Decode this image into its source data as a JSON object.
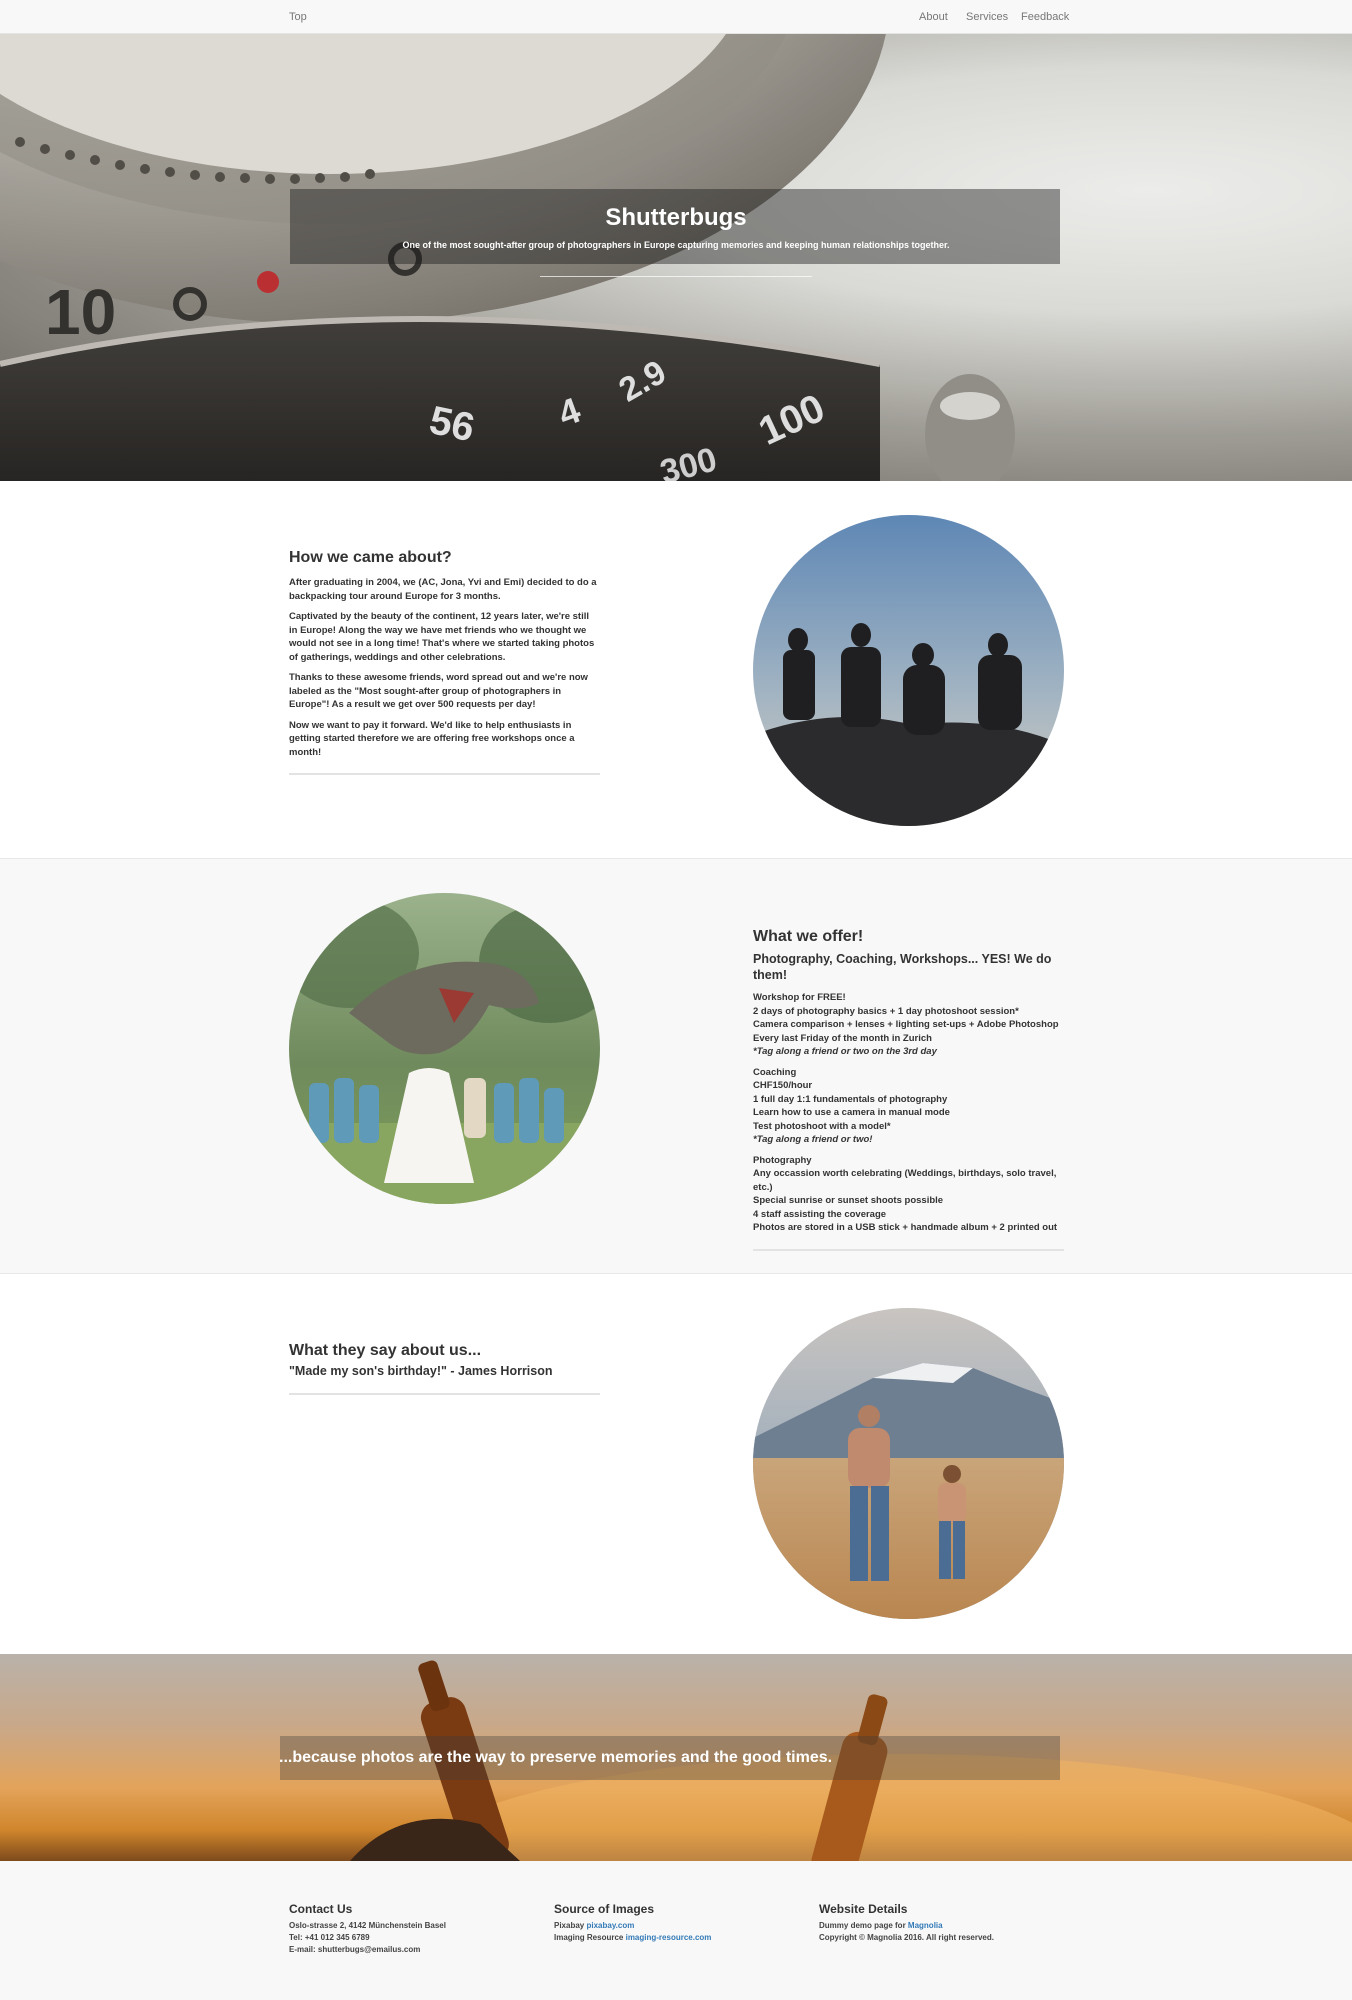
{
  "nav": {
    "top": "Top",
    "about": "About",
    "services": "Services",
    "feedback": "Feedback"
  },
  "hero": {
    "title": "Shutterbugs",
    "subtitle": "One of the most sought-after group of photographers in Europe capturing memories and keeping human relationships together."
  },
  "about": {
    "heading": "How we came about?",
    "p1": "After graduating in 2004, we (AC, Jona, Yvi and Emi) decided to do a backpacking tour around Europe for 3 months.",
    "p2": "Captivated by the beauty of the continent, 12 years later, we're still in Europe! Along the way we have met friends who we thought we would not see in a long time! That's where we started taking photos of gatherings, weddings and other celebrations.",
    "p3": "Thanks to these awesome friends, word spread out and we're now labeled as the \"Most sought-after group of photographers in Europe\"! As a result we get over 500 requests per day!",
    "p4": "Now we want to pay it forward. We'd like to help enthusiasts in getting started therefore we are offering free workshops once a month!"
  },
  "offer": {
    "heading": "What we offer!",
    "subheading": "Photography, Coaching, Workshops... YES! We do them!",
    "workshop": [
      "Workshop for FREE!",
      "2 days of photography basics + 1 day photoshoot session*",
      "Camera comparison + lenses + lighting set-ups + Adobe Photoshop",
      "Every last Friday of the month in Zurich"
    ],
    "workshop_note": "*Tag along a friend or two on the 3rd day",
    "coaching": [
      "Coaching",
      "CHF150/hour",
      "1 full day 1:1 fundamentals of photography",
      "Learn how to use a camera in manual mode",
      "Test photoshoot with a model*"
    ],
    "coaching_note": "*Tag along a friend or two!",
    "photography": [
      "Photography",
      "Any occassion worth celebrating (Weddings, birthdays, solo travel, etc.)",
      "Special sunrise or sunset shoots possible",
      "4 staff assisting the coverage",
      "Photos are stored in a USB stick + handmade album + 2 printed out"
    ]
  },
  "testimonials": {
    "heading": "What they say about us...",
    "quote": "\"Made my son's birthday!\" - James Horrison"
  },
  "banner": {
    "text": "...because photos are the way to preserve memories and the good times."
  },
  "footer": {
    "contact": {
      "heading": "Contact Us",
      "address": "Oslo-strasse 2, 4142 Münchenstein Basel",
      "tel": "Tel: +41 012 345 6789",
      "email": "E-mail: shutterbugs@emailus.com"
    },
    "sources": {
      "heading": "Source of Images",
      "pixabay_prefix": "Pixabay",
      "pixabay_link": "pixabay.com",
      "imaging_prefix": "Imaging Resource",
      "imaging_link": "imaging-resource.com"
    },
    "details": {
      "heading": "Website Details",
      "demo_prefix": "Dummy demo page for",
      "demo_link": "Magnolia",
      "copyright": "Copyright © Magnolia 2016. All right reserved."
    }
  }
}
